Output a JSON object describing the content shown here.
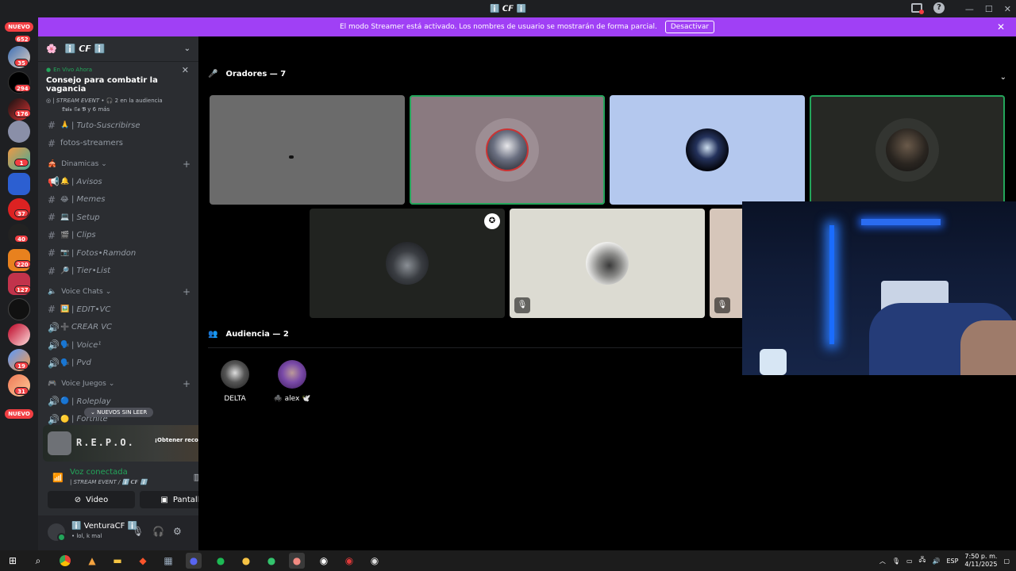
{
  "window": {
    "title": "ℹ️ 𝘾𝙁 ℹ️"
  },
  "banner": {
    "message": "El modo Streamer está activado. Los nombres de usuario se mostrarán de forma parcial.",
    "deactivate_label": "Desactivar"
  },
  "guilds": {
    "new_top": "NUEVO",
    "new_bottom": "NUEVO",
    "badges": [
      "652",
      "35",
      "294",
      "176",
      "1",
      "37",
      "40",
      "220",
      "127",
      "19",
      "31"
    ]
  },
  "server": {
    "name": "ℹ️ 𝘾𝙁 ℹ️",
    "live": {
      "status": "En Vivo Ahora",
      "title": "Consejo para combatir la vagancia",
      "event": "| STREAM EVENT",
      "audience": "2 en la audiencia",
      "users": "𝕷𝖚𝖎𝖘 𝕾𝖆 𝕭 y 6 más"
    },
    "channels": [
      {
        "emoji": "🙏",
        "name": "| Tuto-Suscribirse"
      },
      {
        "emoji": "",
        "name": "fotos-streamers"
      }
    ],
    "cat_dinamicas": "Dinamicas",
    "dinamicas": [
      {
        "icon": "📢",
        "emoji": "🔔",
        "name": "| Avisos"
      },
      {
        "icon": "#",
        "emoji": "😂",
        "name": "| Memes"
      },
      {
        "icon": "#",
        "emoji": "💻",
        "name": "| Setup"
      },
      {
        "icon": "#",
        "emoji": "🎬",
        "name": "| Clips"
      },
      {
        "icon": "#",
        "emoji": "📷",
        "name": "| Fotos•Ramdon"
      },
      {
        "icon": "#",
        "emoji": "🔎",
        "name": "| Tier•List"
      }
    ],
    "cat_voice": "Voice Chats",
    "voice": [
      {
        "icon": "#",
        "emoji": "🖼️",
        "name": "| EDIT•VC"
      },
      {
        "icon": "🔊",
        "emoji": "➕",
        "name": "CREAR VC"
      },
      {
        "icon": "🔊",
        "emoji": "🗣️",
        "name": "| Voice¹"
      },
      {
        "icon": "🔊",
        "emoji": "🗣️",
        "name": "| Pvd"
      }
    ],
    "cat_juegos": "Voice Juegos",
    "juegos": [
      {
        "icon": "🔊",
        "emoji": "🔵",
        "name": "| Roleplay"
      },
      {
        "icon": "🔊",
        "emoji": "🟡",
        "name": "| Fortnite"
      }
    ],
    "unread_label": "NUEVOS SIN LEER"
  },
  "promo": {
    "logo_text": "R.E.P.O.",
    "claim_label": "¡Obtener recompensa!"
  },
  "voice": {
    "status": "Voz conectada",
    "channel": "| STREAM EVENT / ℹ️ 𝘾𝙁 ℹ️",
    "video_label": "Video",
    "screen_label": "Pantalla"
  },
  "user": {
    "name": "ℹ️ VenturaCF ℹ️",
    "status": "• lol, k mal"
  },
  "stage": {
    "speakers_label": "Oradores — 7",
    "audience_label": "Audiencia — 2",
    "audience": [
      {
        "name": "DELTA"
      },
      {
        "name": "🕷️ alex 🕊️"
      }
    ]
  },
  "taskbar": {
    "lang": "ESP",
    "time": "7:50 p. m.",
    "date": "4/11/2025"
  },
  "colors": {
    "banner": "#a040f5",
    "speaking": "#23a55a",
    "badge": "#f23f43"
  }
}
